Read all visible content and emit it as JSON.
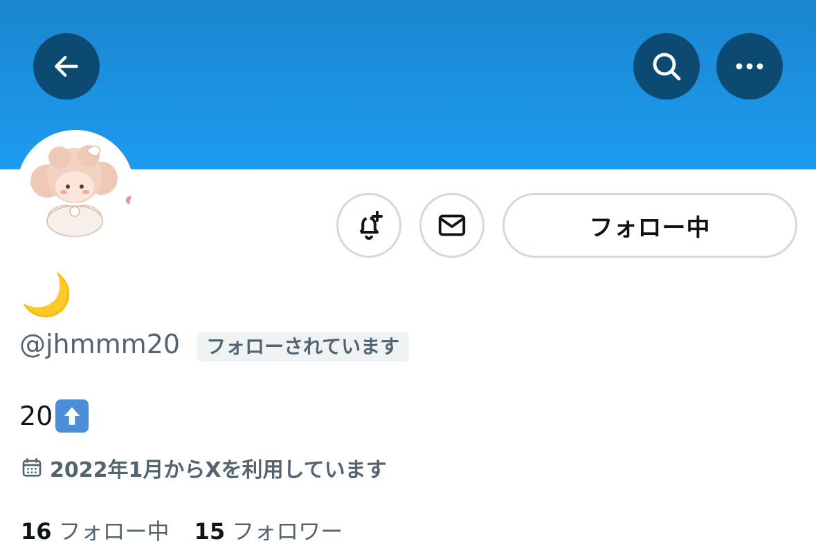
{
  "header": {
    "back_icon": "arrow-left-icon",
    "search_icon": "search-icon",
    "more_icon": "more-dots-icon",
    "banner_color": "#1d9bf0"
  },
  "profile": {
    "display_name": "🌙",
    "handle": "@jhmmm20",
    "follows_you_badge": "フォローされています",
    "bio_text": "20",
    "bio_emoji": "up-arrow-emoji",
    "joined_text": "2022年1月からXを利用しています",
    "joined_icon": "calendar-icon"
  },
  "actions": {
    "notify_icon": "bell-plus-icon",
    "message_icon": "envelope-icon",
    "follow_label": "フォロー中"
  },
  "stats": {
    "following_count": "16",
    "following_label": "フォロー中",
    "followers_count": "15",
    "followers_label": "フォロワー"
  }
}
